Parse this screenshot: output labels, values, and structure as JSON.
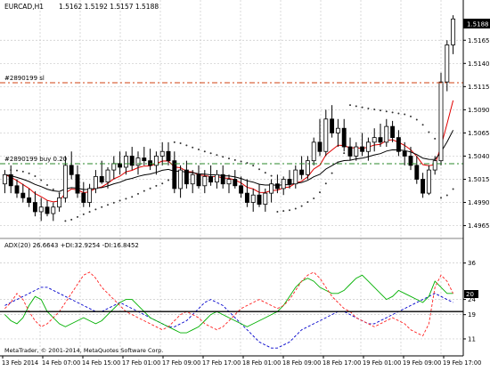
{
  "main_header": {
    "symbol_tf": "EURCAD,H1",
    "ohlc": "1.5162 1.5192 1.5157 1.5188"
  },
  "order_lines": {
    "sl_label": "#2890199 sl",
    "buy_label": "#2890199 buy 0.20",
    "sl_color": "#d04010",
    "buy_color": "#2a8a2a"
  },
  "price_axis": {
    "current_price": "1.5188",
    "ticks": [
      "1.5165",
      "1.5140",
      "1.5115",
      "1.5090",
      "1.5065",
      "1.5040",
      "1.5015",
      "1.4990",
      "1.4965"
    ]
  },
  "adx_header": {
    "text": "ADX(20) 26.6643 +DI:32.9254 -DI:16.8452"
  },
  "adx_axis": {
    "ticks": [
      "36",
      "24",
      "19",
      "11"
    ],
    "current_label": "20"
  },
  "time_axis": {
    "labels": [
      "13 Feb 2014",
      "14 Feb 07:00",
      "14 Feb 15:00",
      "17 Feb 01:00",
      "17 Feb 09:00",
      "17 Feb 17:00",
      "18 Feb 01:00",
      "18 Feb 09:00",
      "18 Feb 17:00",
      "19 Feb 01:00",
      "19 Feb 09:00",
      "19 Feb 17:00"
    ]
  },
  "copyright": "MetaTrader, © 2001-2014, MetaQuotes Software Corp.",
  "colors": {
    "bull_candle": "#ffffff",
    "bear_candle": "#000000",
    "ma_fast": "#e00000",
    "ma_slow": "#000000",
    "sar_dots": "#333333",
    "adx_line": "#0000cc",
    "plus_di": "#00b000",
    "minus_di": "#ff2020",
    "grid": "#c8c8c8"
  },
  "chart_data": [
    {
      "type": "candlestick",
      "title": "EURCAD,H1",
      "ylim": [
        1.4955,
        1.5195
      ],
      "candles": [
        [
          1.501,
          1.5025,
          1.5,
          1.502
        ],
        [
          1.502,
          1.503,
          1.5,
          1.5008
        ],
        [
          1.5008,
          1.5015,
          1.4995,
          1.5
        ],
        [
          1.5,
          1.501,
          1.499,
          1.4995
        ],
        [
          1.4995,
          1.5005,
          1.4985,
          1.499
        ],
        [
          1.499,
          1.5002,
          1.4975,
          1.498
        ],
        [
          1.498,
          1.4995,
          1.497,
          1.4985
        ],
        [
          1.4985,
          1.4992,
          1.4975,
          1.4978
        ],
        [
          1.4978,
          1.499,
          1.497,
          1.4985
        ],
        [
          1.4985,
          1.5,
          1.498,
          1.4995
        ],
        [
          1.4995,
          1.504,
          1.499,
          1.503
        ],
        [
          1.503,
          1.5045,
          1.5015,
          1.502
        ],
        [
          1.502,
          1.503,
          1.4995,
          1.5
        ],
        [
          1.5,
          1.5012,
          1.4985,
          1.499
        ],
        [
          1.499,
          1.501,
          1.4985,
          1.5005
        ],
        [
          1.5005,
          1.5025,
          1.5,
          1.5018
        ],
        [
          1.5018,
          1.5035,
          1.501,
          1.5012
        ],
        [
          1.5012,
          1.5028,
          1.5005,
          1.5025
        ],
        [
          1.5025,
          1.504,
          1.5015,
          1.5032
        ],
        [
          1.5032,
          1.5045,
          1.502,
          1.5028
        ],
        [
          1.5028,
          1.5045,
          1.502,
          1.504
        ],
        [
          1.504,
          1.505,
          1.5025,
          1.503
        ],
        [
          1.503,
          1.5045,
          1.502,
          1.5038
        ],
        [
          1.5038,
          1.505,
          1.503,
          1.5035
        ],
        [
          1.5035,
          1.5048,
          1.5025,
          1.503
        ],
        [
          1.503,
          1.5045,
          1.502,
          1.504
        ],
        [
          1.504,
          1.5055,
          1.503,
          1.5045
        ],
        [
          1.5045,
          1.5055,
          1.503,
          1.5035
        ],
        [
          1.5035,
          1.5045,
          1.5,
          1.5005
        ],
        [
          1.5005,
          1.503,
          1.4995,
          1.5025
        ],
        [
          1.5025,
          1.5035,
          1.5005,
          1.501
        ],
        [
          1.501,
          1.5025,
          1.5,
          1.502
        ],
        [
          1.502,
          1.503,
          1.5005,
          1.5008
        ],
        [
          1.5008,
          1.5025,
          1.5,
          1.5018
        ],
        [
          1.5018,
          1.503,
          1.5008,
          1.5012
        ],
        [
          1.5012,
          1.5025,
          1.5005,
          1.502
        ],
        [
          1.502,
          1.503,
          1.5005,
          1.501
        ],
        [
          1.501,
          1.502,
          1.5,
          1.5015
        ],
        [
          1.5015,
          1.5025,
          1.5005,
          1.5008
        ],
        [
          1.5008,
          1.5018,
          1.4995,
          1.5
        ],
        [
          1.5,
          1.5015,
          1.4985,
          1.499
        ],
        [
          1.499,
          1.5005,
          1.498,
          1.4998
        ],
        [
          1.4998,
          1.501,
          1.4985,
          1.4988
        ],
        [
          1.4988,
          1.5005,
          1.498,
          1.5
        ],
        [
          1.5,
          1.5015,
          1.499,
          1.501
        ],
        [
          1.501,
          1.502,
          1.5,
          1.5005
        ],
        [
          1.5005,
          1.5018,
          1.4998,
          1.5015
        ],
        [
          1.5015,
          1.5025,
          1.5005,
          1.501
        ],
        [
          1.501,
          1.503,
          1.5005,
          1.5025
        ],
        [
          1.5025,
          1.504,
          1.5015,
          1.502
        ],
        [
          1.502,
          1.504,
          1.5015,
          1.5035
        ],
        [
          1.5035,
          1.506,
          1.503,
          1.5055
        ],
        [
          1.5055,
          1.508,
          1.504,
          1.5045
        ],
        [
          1.5045,
          1.509,
          1.504,
          1.508
        ],
        [
          1.508,
          1.5095,
          1.506,
          1.5065
        ],
        [
          1.5065,
          1.508,
          1.505,
          1.507
        ],
        [
          1.507,
          1.508,
          1.5045,
          1.505
        ],
        [
          1.505,
          1.506,
          1.5035,
          1.504
        ],
        [
          1.504,
          1.5055,
          1.5035,
          1.505
        ],
        [
          1.505,
          1.5065,
          1.504,
          1.5045
        ],
        [
          1.5045,
          1.506,
          1.5035,
          1.5055
        ],
        [
          1.5055,
          1.507,
          1.5045,
          1.506
        ],
        [
          1.506,
          1.5075,
          1.505,
          1.5055
        ],
        [
          1.5055,
          1.508,
          1.505,
          1.5072
        ],
        [
          1.5072,
          1.5078,
          1.5055,
          1.506
        ],
        [
          1.506,
          1.5068,
          1.504,
          1.5045
        ],
        [
          1.5045,
          1.5055,
          1.503,
          1.504
        ],
        [
          1.504,
          1.505,
          1.5025,
          1.503
        ],
        [
          1.503,
          1.504,
          1.501,
          1.5015
        ],
        [
          1.5015,
          1.5022,
          1.4995,
          1.5
        ],
        [
          1.5,
          1.503,
          1.4998,
          1.5025
        ],
        [
          1.5025,
          1.504,
          1.502,
          1.5035
        ],
        [
          1.5035,
          1.513,
          1.503,
          1.512
        ],
        [
          1.512,
          1.5165,
          1.511,
          1.516
        ],
        [
          1.516,
          1.5192,
          1.515,
          1.5188
        ]
      ]
    },
    {
      "type": "line",
      "title": "ADX(20) 26.6643 +DI:32.9254 -DI:16.8452",
      "ylim": [
        6,
        40
      ],
      "series": [
        {
          "name": "ADX",
          "values": [
            22,
            23,
            24,
            25,
            26,
            27,
            28,
            28,
            27,
            26,
            25,
            24,
            23,
            22,
            21,
            20,
            20,
            21,
            22,
            23,
            22,
            21,
            20,
            19,
            18,
            17,
            16,
            15,
            15,
            16,
            17,
            19,
            21,
            23,
            24,
            23,
            22,
            20,
            18,
            16,
            14,
            12,
            10,
            9,
            8,
            8,
            9,
            10,
            12,
            14,
            15,
            16,
            17,
            18,
            19,
            20,
            20,
            19,
            18,
            17,
            16,
            16,
            17,
            18,
            19,
            20,
            21,
            22,
            23,
            24,
            25,
            26,
            25,
            24,
            23
          ]
        },
        {
          "name": "+DI",
          "values": [
            19,
            17,
            16,
            18,
            22,
            25,
            24,
            20,
            18,
            16,
            15,
            16,
            17,
            18,
            17,
            16,
            17,
            19,
            21,
            23,
            24,
            24,
            22,
            20,
            18,
            17,
            16,
            15,
            14,
            13,
            13,
            14,
            15,
            17,
            19,
            20,
            19,
            18,
            17,
            16,
            15,
            16,
            17,
            18,
            19,
            20,
            22,
            25,
            28,
            30,
            31,
            30,
            28,
            27,
            26,
            26,
            27,
            29,
            31,
            32,
            30,
            28,
            26,
            24,
            25,
            27,
            26,
            25,
            24,
            23,
            25,
            30,
            28,
            26,
            26
          ]
        },
        {
          "name": "-DI",
          "values": [
            21,
            23,
            26,
            24,
            20,
            17,
            15,
            16,
            18,
            20,
            23,
            26,
            29,
            32,
            33,
            31,
            28,
            26,
            24,
            22,
            20,
            19,
            18,
            17,
            16,
            15,
            14,
            15,
            17,
            19,
            20,
            19,
            18,
            16,
            15,
            14,
            15,
            17,
            19,
            21,
            22,
            23,
            24,
            23,
            22,
            21,
            22,
            24,
            27,
            30,
            32,
            33,
            31,
            28,
            25,
            23,
            21,
            20,
            18,
            17,
            16,
            15,
            16,
            17,
            18,
            17,
            16,
            14,
            13,
            12,
            16,
            28,
            32,
            30,
            26
          ]
        }
      ]
    }
  ]
}
